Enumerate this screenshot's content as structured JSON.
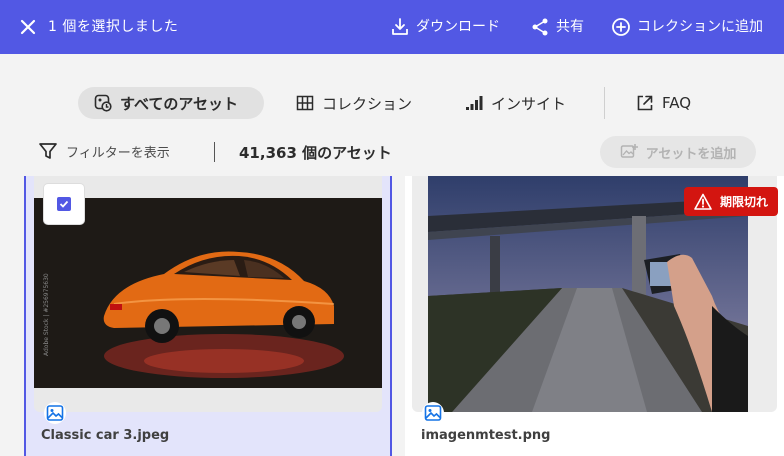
{
  "selection_bar": {
    "selected_text": "1 個を選択しました",
    "download": "ダウンロード",
    "share": "共有",
    "add_to_collection": "コレクションに追加"
  },
  "tabs": [
    {
      "label": "すべてのアセット",
      "active": true
    },
    {
      "label": "コレクション",
      "active": false
    },
    {
      "label": "インサイト",
      "active": false
    },
    {
      "label": "FAQ",
      "active": false
    }
  ],
  "toolbar": {
    "filter_label": "フィルターを表示",
    "asset_count": "41,363 個のアセット",
    "add_asset_label": "アセットを追加"
  },
  "assets": [
    {
      "filename": "Classic car 3.jpeg",
      "selected": true,
      "watermark": "Adobe Stock | #256975630"
    },
    {
      "filename": "imagenmtest.png",
      "selected": false,
      "badge": "期限切れ"
    }
  ],
  "colors": {
    "accent": "#5258e4",
    "expired": "#d31510"
  }
}
